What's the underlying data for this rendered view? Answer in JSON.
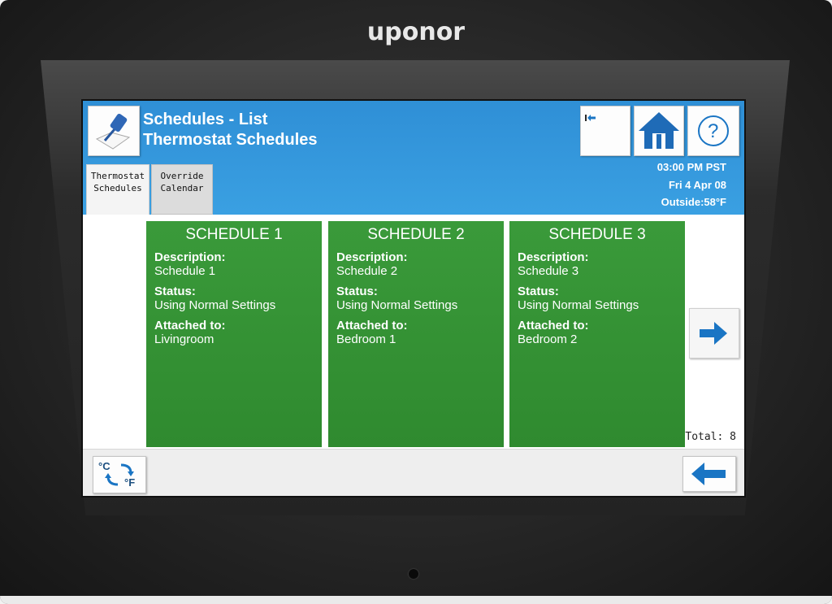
{
  "brand": "uponor",
  "header": {
    "title_line1": "Schedules - List",
    "title_line2": "Thermostat Schedules",
    "time": "03:00 PM PST",
    "date": "Fri 4 Apr 08",
    "outside": "Outside:58°F"
  },
  "tabs": [
    {
      "label_line1": "Thermostat",
      "label_line2": "Schedules",
      "active": true
    },
    {
      "label_line1": "Override",
      "label_line2": "Calendar",
      "active": false
    }
  ],
  "labels": {
    "description": "Description:",
    "status": "Status:",
    "attached": "Attached to:"
  },
  "schedules": [
    {
      "title": "SCHEDULE 1",
      "description": "Schedule 1",
      "status": "Using Normal Settings",
      "attached_to": "Livingroom"
    },
    {
      "title": "SCHEDULE 2",
      "description": "Schedule 2",
      "status": "Using Normal Settings",
      "attached_to": "Bedroom 1"
    },
    {
      "title": "SCHEDULE 3",
      "description": "Schedule 3",
      "status": "Using Normal Settings",
      "attached_to": "Bedroom 2"
    }
  ],
  "total": "Total: 8",
  "footer": {
    "unit_c": "°C",
    "unit_f": "°F"
  },
  "icons": {
    "pin": "pushpin-icon",
    "back_small": "back-small-icon",
    "home": "home-icon",
    "help": "help-icon",
    "next": "right-arrow-icon",
    "unit_toggle": "celsius-fahrenheit-toggle-icon",
    "back": "left-arrow-icon"
  },
  "colors": {
    "header_blue": "#3399dd",
    "card_green": "#2f8a2f",
    "arrow_blue": "#1a75c4"
  }
}
